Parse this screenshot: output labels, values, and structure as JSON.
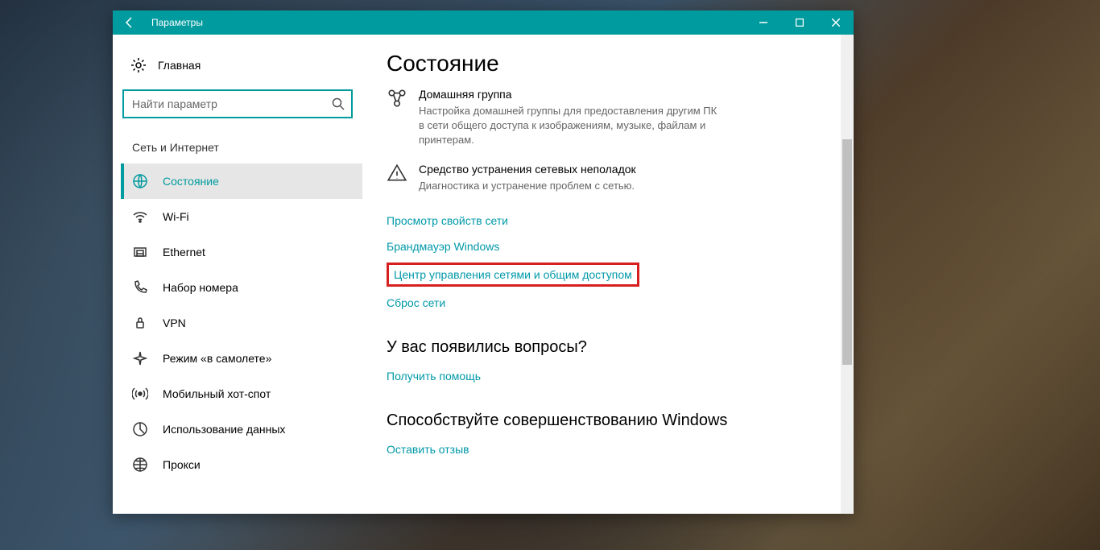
{
  "window": {
    "title": "Параметры"
  },
  "sidebar": {
    "home": "Главная",
    "search": {
      "placeholder": "Найти параметр"
    },
    "section": "Сеть и Интернет",
    "items": [
      {
        "id": "status",
        "label": "Состояние",
        "active": true
      },
      {
        "id": "wifi",
        "label": "Wi-Fi"
      },
      {
        "id": "ethernet",
        "label": "Ethernet"
      },
      {
        "id": "dialup",
        "label": "Набор номера"
      },
      {
        "id": "vpn",
        "label": "VPN"
      },
      {
        "id": "airplane",
        "label": "Режим «в самолете»"
      },
      {
        "id": "hotspot",
        "label": "Мобильный хот-спот"
      },
      {
        "id": "datausage",
        "label": "Использование данных"
      },
      {
        "id": "proxy",
        "label": "Прокси"
      }
    ]
  },
  "main": {
    "pageTitle": "Состояние",
    "blocks": [
      {
        "title": "Домашняя группа",
        "desc": "Настройка домашней группы для предоставления другим ПК в сети общего доступа к изображениям, музыке, файлам и принтерам."
      },
      {
        "title": "Средство устранения сетевых неполадок",
        "desc": "Диагностика и устранение проблем с сетью."
      }
    ],
    "links": [
      "Просмотр свойств сети",
      "Брандмауэр Windows",
      "Центр управления сетями и общим доступом",
      "Сброс сети"
    ],
    "faq": {
      "title": "У вас появились вопросы?",
      "link": "Получить помощь"
    },
    "feedback": {
      "title": "Способствуйте совершенствованию Windows",
      "link": "Оставить отзыв"
    }
  }
}
